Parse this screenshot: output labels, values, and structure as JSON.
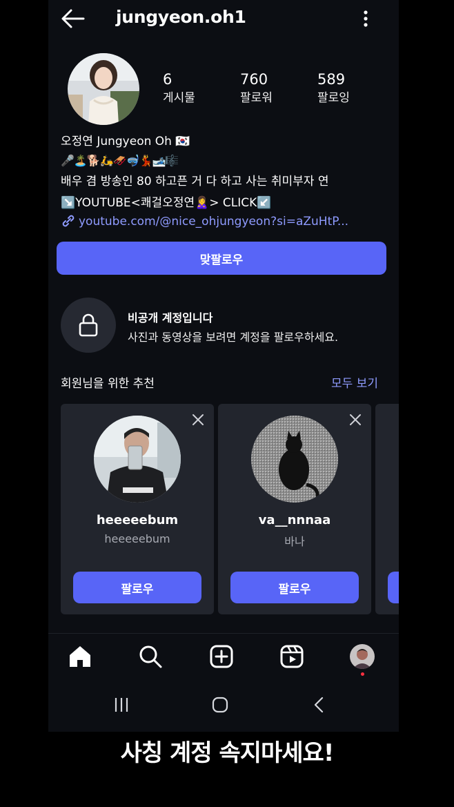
{
  "header": {
    "username": "jungyeon.oh1",
    "icons": [
      "arrow-left-icon",
      "more-vertical-icon"
    ]
  },
  "stats": [
    {
      "value": "6",
      "label": "게시물"
    },
    {
      "value": "760",
      "label": "팔로워"
    },
    {
      "value": "589",
      "label": "팔로잉"
    }
  ],
  "bio": {
    "name": "오정연 Jungyeon Oh 🇰🇷",
    "emoji_line": "🎤🏝️🐕🛵🛷🤿💃🎿🎼",
    "text": "배우 겸 방송인 80 하고픈 거 다 하고 사는 취미부자 연",
    "youtube": "↘️YOUTUBE<쾌걸오정연🙎‍♀️> CLICK↙️",
    "link": "youtube.com/@nice_ohjungyeon?si=aZuHtP..."
  },
  "follow_back_label": "맞팔로우",
  "private": {
    "title": "비공개 계정입니다",
    "subtitle": "사진과 동영상을 보려면 계정을 팔로우하세요."
  },
  "suggestions": {
    "title": "회원님을 위한 추천",
    "see_all": "모두 보기",
    "cards": [
      {
        "name": "heeeeebum",
        "username": "heeeeebum",
        "button": "팔로우"
      },
      {
        "name": "va__nnnaa",
        "username": "바나",
        "button": "팔로우"
      }
    ]
  },
  "bottom_nav": [
    "home-icon",
    "search-icon",
    "create-icon",
    "reels-icon",
    "profile-icon"
  ],
  "accent_color": "#5865f7",
  "link_color": "#8f9bff",
  "caption": "사칭 계정 속지마세요!"
}
